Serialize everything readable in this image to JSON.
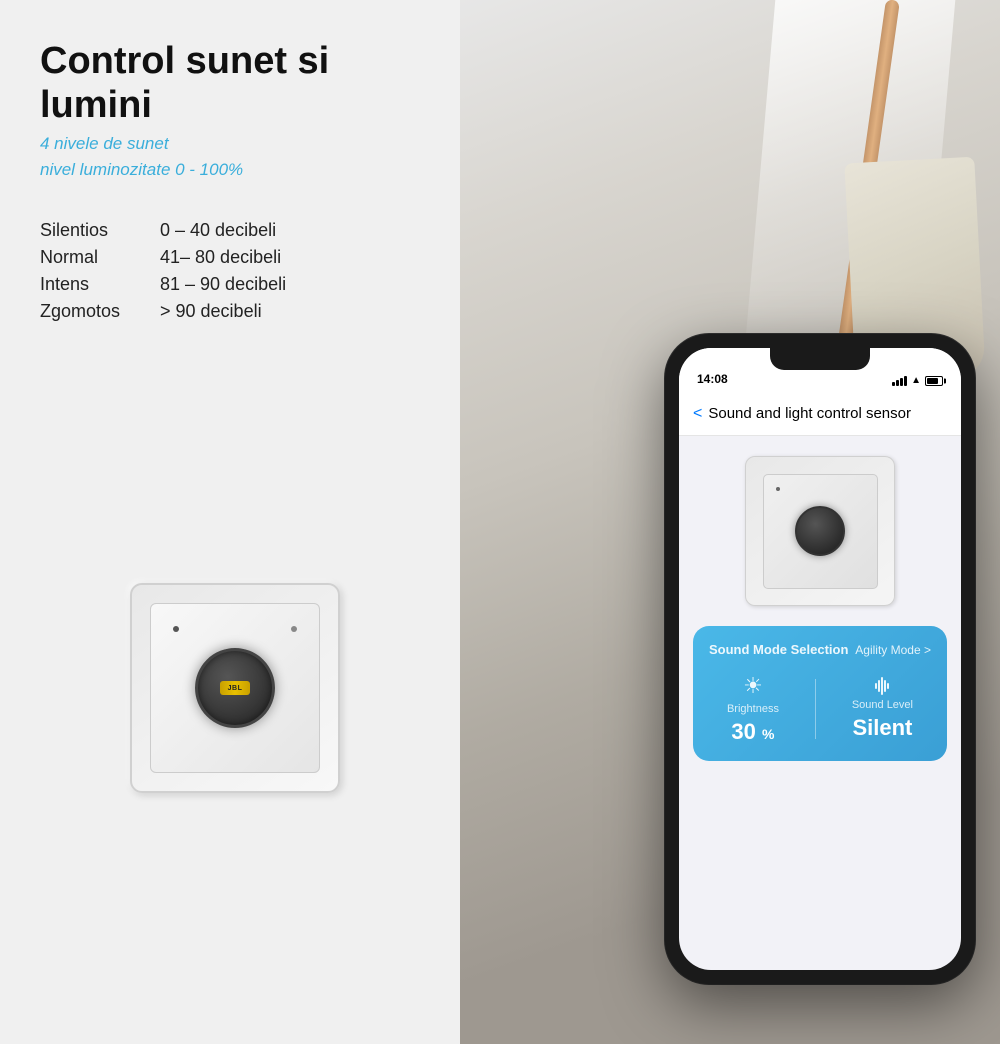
{
  "page": {
    "title": "Control sunet si lumini",
    "subtitle1": "4 nivele de sunet",
    "subtitle2": "nivel luminozitate 0 - 100%",
    "accent_color": "#3aaedb",
    "bg_color": "#f0f0f0"
  },
  "sound_levels": [
    {
      "name": "Silentios",
      "range": "0 – 40 decibeli"
    },
    {
      "name": "Normal",
      "range": "41– 80 decibeli"
    },
    {
      "name": "Intens",
      "range": "81 – 90 decibeli"
    },
    {
      "name": "Zgomotos",
      "range": "> 90 decibeli"
    }
  ],
  "phone": {
    "status_time": "14:08",
    "nav_back_label": "<",
    "nav_title": "Sound and light control sensor",
    "card_title": "Sound Mode Selection",
    "card_mode": "Agility Mode >",
    "brightness_label": "Brightness",
    "brightness_value": "30",
    "brightness_unit": "%",
    "sound_label": "Sound Level",
    "sound_value": "Silent"
  }
}
